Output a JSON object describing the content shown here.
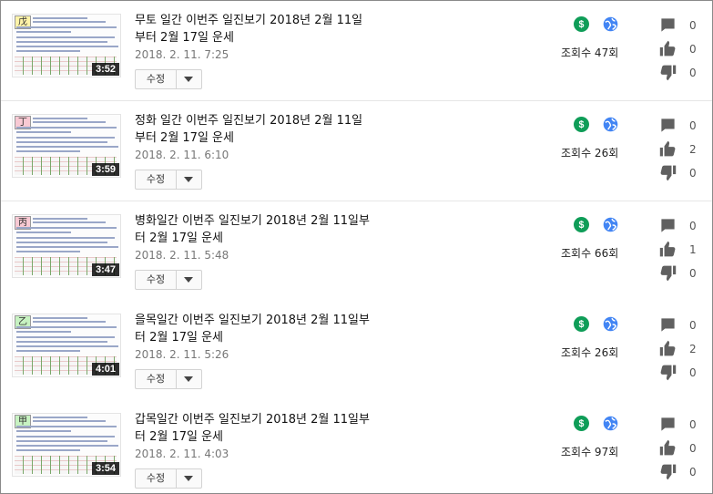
{
  "edit_label": "수정",
  "colors": {
    "monetization": "#0f9d58",
    "visibility": "#4285f4",
    "icon_gray": "#606060"
  },
  "videos": [
    {
      "hanja": "戊",
      "duration": "3:52",
      "title": "무토 일간 이번주 일진보기 2018년 2월 11일부터 2월 17일 운세",
      "date": "2018. 2. 11. 7:25",
      "views": "조회수 47회",
      "comments": "0",
      "likes": "0",
      "dislikes": "0"
    },
    {
      "hanja": "丁",
      "duration": "3:59",
      "title": "정화 일간 이번주 일진보기 2018년 2월 11일부터 2월 17일 운세",
      "date": "2018. 2. 11. 6:10",
      "views": "조회수 26회",
      "comments": "0",
      "likes": "2",
      "dislikes": "0"
    },
    {
      "hanja": "丙",
      "duration": "3:47",
      "title": "병화일간 이번주 일진보기 2018년 2월 11일부터 2월 17일 운세",
      "date": "2018. 2. 11. 5:48",
      "views": "조회수 66회",
      "comments": "0",
      "likes": "1",
      "dislikes": "0"
    },
    {
      "hanja": "乙",
      "duration": "4:01",
      "title": "을목일간 이번주 일진보기 2018년 2월 11일부터 2월 17일 운세",
      "date": "2018. 2. 11. 5:26",
      "views": "조회수 26회",
      "comments": "0",
      "likes": "2",
      "dislikes": "0"
    },
    {
      "hanja": "甲",
      "duration": "3:54",
      "title": "갑목일간 이번주 일진보기 2018년 2월 11일부터 2월 17일 운세",
      "date": "2018. 2. 11. 4:03",
      "views": "조회수 97회",
      "comments": "0",
      "likes": "0",
      "dislikes": "0"
    }
  ]
}
